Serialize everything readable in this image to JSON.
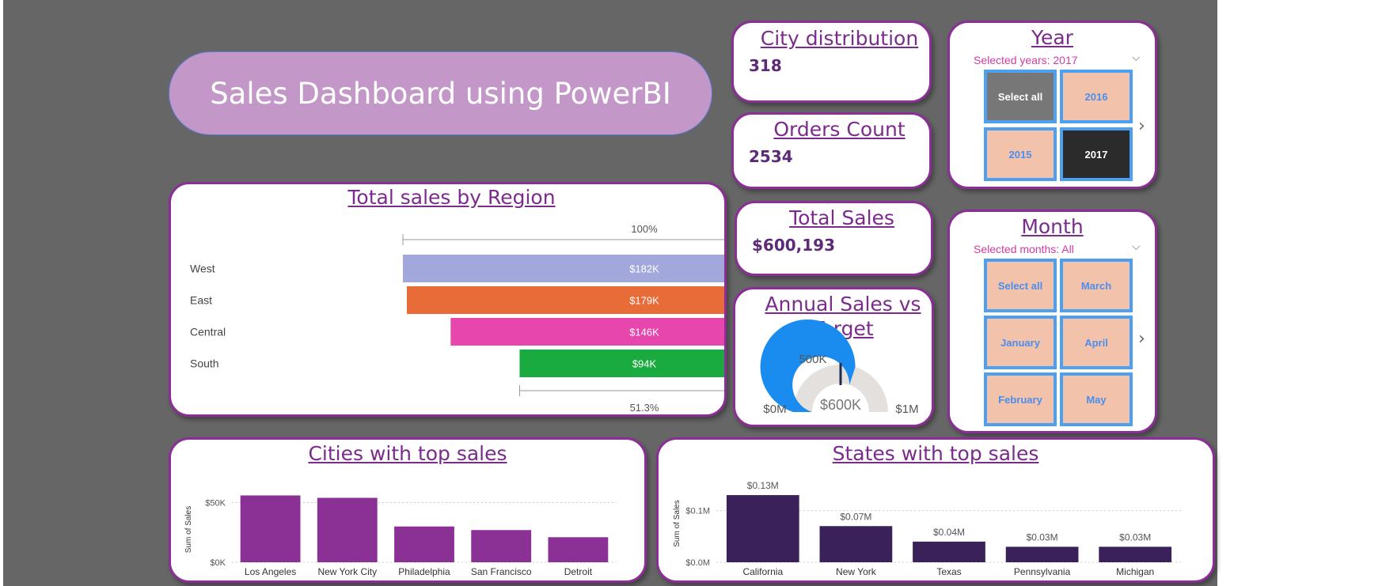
{
  "dashboard": {
    "title": "Sales Dashboard using PowerBI"
  },
  "kpis": {
    "city": {
      "title": "City distribution",
      "value": "318"
    },
    "orders": {
      "title": "Orders Count",
      "value": "2534"
    },
    "sales": {
      "title": "Total Sales",
      "value": "$600,193"
    }
  },
  "year_slicer": {
    "title": "Year",
    "selection": "Selected years: 2017",
    "tiles": [
      "Select all",
      "2016",
      "2015",
      "2017"
    ]
  },
  "month_slicer": {
    "title": "Month",
    "selection": "Selected months: All",
    "tiles": [
      "Select all",
      "March",
      "January",
      "April",
      "February",
      "May"
    ]
  },
  "gauge": {
    "title_line1": "Annual Sales vs",
    "title_line2": "Target",
    "min_label": "$0M",
    "max_label": "$1M",
    "target_label": "500K",
    "value_label": "$600K",
    "min": 0,
    "max": 1000000,
    "value": 600193,
    "target": 500000
  },
  "colors": {
    "accent": "#8b2e95",
    "bar_purple": "#8b3195",
    "bar_dark": "#3a2159",
    "slicer_tile": "#f3c2aa",
    "slicer_border": "#4d9ff0"
  },
  "chart_data": [
    {
      "type": "bar",
      "orientation": "funnel",
      "title": "Total sales by Region",
      "categories": [
        "West",
        "East",
        "Central",
        "South"
      ],
      "values": [
        182000,
        179000,
        146000,
        94000
      ],
      "value_labels": [
        "$182K",
        "$179K",
        "$146K",
        "$94K"
      ],
      "colors": [
        "#a2a8dc",
        "#e86c38",
        "#e746ac",
        "#1aab40"
      ],
      "top_label": "100%",
      "bottom_label": "51.3%"
    },
    {
      "type": "bar",
      "title": "Cities with top sales",
      "categories": [
        "Los Angeles",
        "New York City",
        "Philadelphia",
        "San Francisco",
        "Detroit"
      ],
      "values": [
        56000,
        54000,
        30000,
        27000,
        21000
      ],
      "ylabel": "Sum of Sales",
      "yticks": [
        "$0K",
        "$50K"
      ],
      "ylim": [
        0,
        55000
      ],
      "grid": true
    },
    {
      "type": "bar",
      "title": "States with top sales",
      "categories": [
        "California",
        "New York",
        "Texas",
        "Pennsylvania",
        "Michigan"
      ],
      "values": [
        0.13,
        0.07,
        0.04,
        0.03,
        0.03
      ],
      "value_labels": [
        "$0.13M",
        "$0.07M",
        "$0.04M",
        "$0.03M",
        "$0.03M"
      ],
      "ylabel": "Sum of Sales",
      "yticks": [
        "$0.0M",
        "$0.1M"
      ],
      "ylim": [
        0,
        0.15
      ],
      "grid": true
    }
  ]
}
